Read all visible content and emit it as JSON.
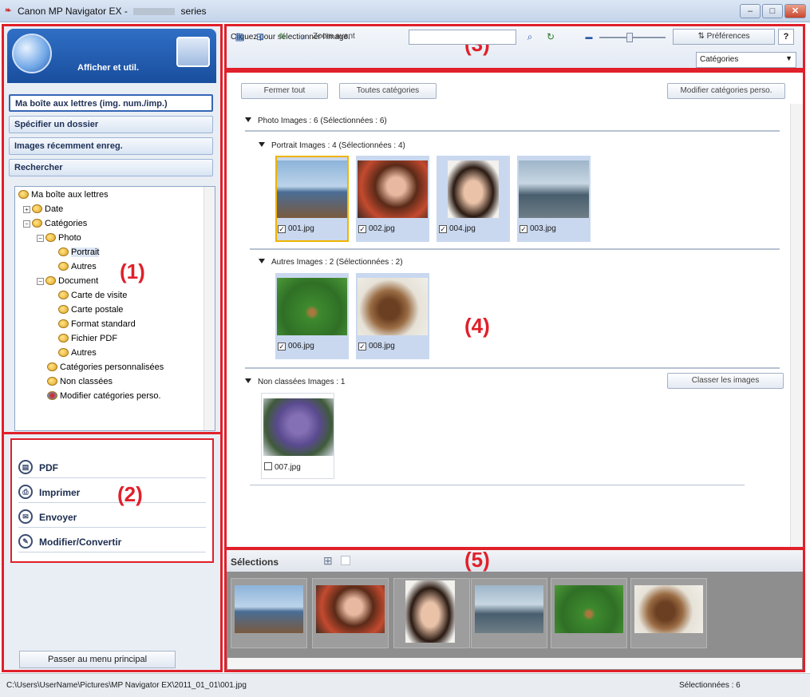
{
  "window": {
    "title_prefix": "Canon MP Navigator EX -",
    "title_suffix": "series",
    "controls": [
      "–",
      "□",
      "✕"
    ]
  },
  "left": {
    "header_label": "Afficher et util.",
    "nav": [
      "Ma boîte aux lettres (img. num./imp.)",
      "Spécifier un dossier",
      "Images récemment enreg.",
      "Rechercher"
    ],
    "tree": [
      {
        "label": "Ma boîte aux lettres",
        "level": 0,
        "pm": ""
      },
      {
        "label": "Date",
        "level": 1,
        "pm": "+"
      },
      {
        "label": "Catégories",
        "level": 1,
        "pm": "−"
      },
      {
        "label": "Photo",
        "level": 2,
        "pm": "−"
      },
      {
        "label": "Portrait",
        "level": 3,
        "pm": "",
        "selected": true
      },
      {
        "label": "Autres",
        "level": 3,
        "pm": ""
      },
      {
        "label": "Document",
        "level": 2,
        "pm": "−"
      },
      {
        "label": "Carte de visite",
        "level": 3,
        "pm": ""
      },
      {
        "label": "Carte postale",
        "level": 3,
        "pm": ""
      },
      {
        "label": "Format standard",
        "level": 3,
        "pm": ""
      },
      {
        "label": "Fichier PDF",
        "level": 3,
        "pm": ""
      },
      {
        "label": "Autres",
        "level": 3,
        "pm": ""
      },
      {
        "label": "Catégories personnalisées",
        "level": 2,
        "pm": ""
      },
      {
        "label": "Non classées",
        "level": 2,
        "pm": ""
      },
      {
        "label": "Modifier catégories perso.",
        "level": 2,
        "pm": ""
      }
    ],
    "actions": [
      "PDF",
      "Imprimer",
      "Envoyer",
      "Modifier/Convertir"
    ],
    "main_menu": "Passer au menu principal"
  },
  "toolbar": {
    "hint": "Cliquez pour sélectionner l'image.",
    "zoom_label": "Zoom avant",
    "preferences": "Préférences",
    "help": "?",
    "category_select": "Catégories"
  },
  "main": {
    "close_all": "Fermer tout",
    "all_categories": "Toutes catégories",
    "edit_custom": "Modifier catégories perso.",
    "groups": {
      "photo": "Photo    Images : 6    (Sélectionnées : 6)",
      "portrait": "Portrait    Images : 4    (Sélectionnées : 4)",
      "autres": "Autres    Images : 2    (Sélectionnées : 2)",
      "unclassified": "Non classées    Images : 1"
    },
    "classify_button": "Classer les images",
    "images": {
      "img001": "001.jpg",
      "img002": "002.jpg",
      "img004": "004.jpg",
      "img003": "003.jpg",
      "img006": "006.jpg",
      "img008": "008.jpg",
      "img007": "007.jpg"
    }
  },
  "selections": {
    "title": "Sélections"
  },
  "status": {
    "path": "C:\\Users\\UserName\\Pictures\\MP Navigator EX\\2011_01_01\\001.jpg",
    "count": "Sélectionnées : 6"
  },
  "region_labels": {
    "r1": "(1)",
    "r2": "(2)",
    "r3": "(3)",
    "r4": "(4)",
    "r5": "(5)"
  }
}
